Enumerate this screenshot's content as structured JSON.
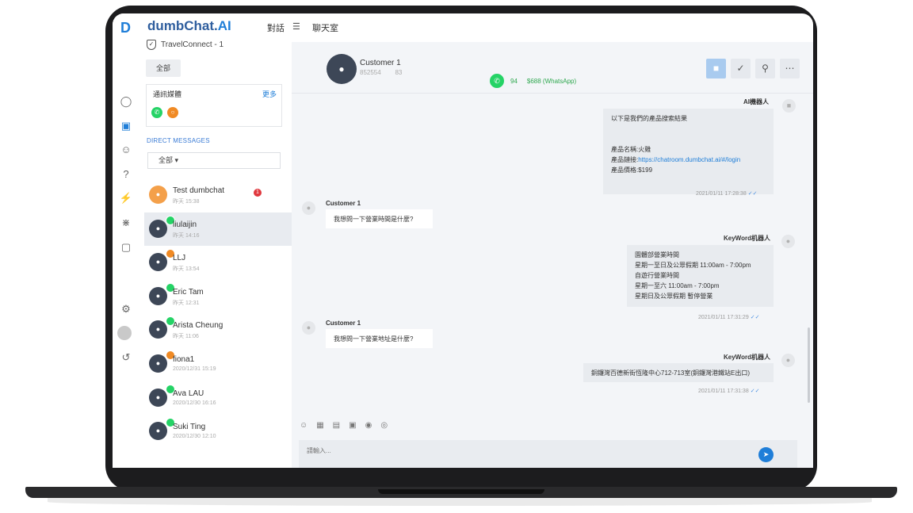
{
  "sidebar": {
    "logo": "D",
    "brand_name": "dumbChat.",
    "brand_ai": "AI",
    "account": "TravelConnect - 1",
    "all_button": "全部",
    "channels_title": "通訊媒體",
    "channels_more": "更多",
    "dm_title": "DIRECT MESSAGES",
    "dm_filter": "全部"
  },
  "top_menu": {
    "conversations": "對話",
    "chatroom": "聊天室"
  },
  "conversations": [
    {
      "name": "Test dumbchat",
      "time": "昨天 15:38",
      "unread": "1",
      "channel": "none",
      "avatar": "orange"
    },
    {
      "name": "liulaijin",
      "time": "昨天 14:16",
      "unread": "",
      "channel": "wa",
      "avatar": "dark"
    },
    {
      "name": "LLJ",
      "time": "昨天 13:54",
      "unread": "",
      "channel": "ch",
      "avatar": "dark"
    },
    {
      "name": "Eric Tam",
      "time": "昨天 12:31",
      "unread": "",
      "channel": "wa",
      "avatar": "dark"
    },
    {
      "name": "Arista Cheung",
      "time": "昨天 11:06",
      "unread": "",
      "channel": "wa",
      "avatar": "dark"
    },
    {
      "name": "fiona1",
      "time": "2020/12/31 15:19",
      "unread": "",
      "channel": "ch",
      "avatar": "dark"
    },
    {
      "name": "Ava LAU",
      "time": "2020/12/30 16:16",
      "unread": "",
      "channel": "wa",
      "avatar": "dark"
    },
    {
      "name": "Suki Ting",
      "time": "2020/12/30 12:10",
      "unread": "",
      "channel": "wa",
      "avatar": "dark"
    }
  ],
  "chat": {
    "name": "Customer 1",
    "id1": "852554",
    "id2": "83",
    "wa_count": "94",
    "wa_label": "$688 (WhatsApp)",
    "messages": {
      "ai_sender": "AI機器人",
      "ai_line1": "以下是我們的產品搜索結果",
      "ai_line2": "產品名稱:火雞",
      "ai_line3_label": "產品鏈接:",
      "ai_line3_link": "https://chatroom.dumbchat.ai/#/login",
      "ai_line4": "產品價格:$199",
      "ai_time": "2021/01/11 17:28:38",
      "c1_sender": "Customer 1",
      "c1_text": "我想問一下營業時間是什麼?",
      "kw1_sender": "KeyWord机器人",
      "kw1_line1": "園體部營業時間",
      "kw1_line2": "星期一至日及公眾假期 11:00am - 7:00pm",
      "kw1_line3": "自遊行營業時間",
      "kw1_line4": "星期一至六 11:00am - 7:00pm",
      "kw1_line5": "星期日及公眾假期 暫停營業",
      "kw1_time": "2021/01/11 17:31:29",
      "c2_sender": "Customer 1",
      "c2_text": "我想問一下營業地址是什麼?",
      "kw2_sender": "KeyWord机器人",
      "kw2_text": "銅鑼灣百德新街恆隆中心712-713室(銅鑼灣港鐵站E出口)",
      "kw2_time": "2021/01/11 17:31:38"
    },
    "composer_placeholder": "請輸入..."
  }
}
